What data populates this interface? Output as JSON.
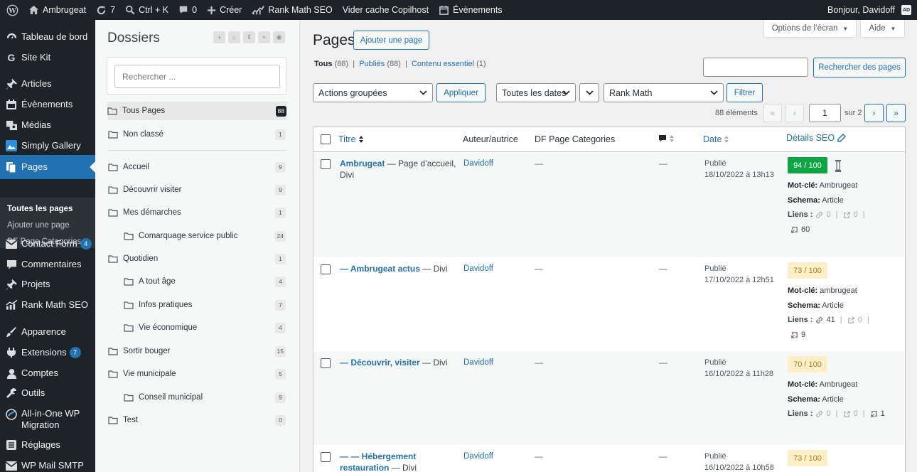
{
  "adminbar": {
    "site_name": "Ambrugeat",
    "updates": "7",
    "search": "Ctrl + K",
    "comments": "0",
    "new": "Créer",
    "rankmath": "Rank Math SEO",
    "cache": "Vider cache Copilhost",
    "events": "Évènements",
    "greeting": "Bonjour, Davidoff",
    "avatar": "AD"
  },
  "menu": {
    "items": [
      {
        "label": "Tableau de bord",
        "icon": "dashboard-icon"
      },
      {
        "label": "Site Kit",
        "icon": "google-icon"
      },
      {
        "label": "Articles",
        "icon": "pin-icon"
      },
      {
        "label": "Évènements",
        "icon": "calendar-icon"
      },
      {
        "label": "Médias",
        "icon": "media-icon"
      },
      {
        "label": "Simply Gallery",
        "icon": "gallery-icon"
      },
      {
        "label": "Pages",
        "icon": "pages-icon"
      },
      {
        "label": "Contact Form",
        "icon": "mail-icon",
        "badge": "4"
      },
      {
        "label": "Commentaires",
        "icon": "comment-icon"
      },
      {
        "label": "Projets",
        "icon": "pin-icon"
      },
      {
        "label": "Rank Math SEO",
        "icon": "chart-icon"
      },
      {
        "label": "Apparence",
        "icon": "brush-icon"
      },
      {
        "label": "Extensions",
        "icon": "plugin-icon",
        "badge": "7"
      },
      {
        "label": "Comptes",
        "icon": "user-icon"
      },
      {
        "label": "Outils",
        "icon": "wrench-icon"
      },
      {
        "label": "All-in-One WP",
        "label2": "Migration",
        "icon": "migration-icon"
      },
      {
        "label": "Réglages",
        "icon": "settings-icon"
      },
      {
        "label": "WP Mail SMTP",
        "icon": "mail-icon"
      }
    ],
    "submenu": [
      "Toutes les pages",
      "Ajouter une page",
      "DF Page Categories"
    ]
  },
  "folders": {
    "title": "Dossiers",
    "search_placeholder": "Rechercher ...",
    "items": [
      {
        "label": "Tous Pages",
        "count": "88"
      },
      {
        "label": "Non classé",
        "count": "1"
      },
      {
        "label": "Accueil",
        "count": "9"
      },
      {
        "label": "Découvrir visiter",
        "count": "9"
      },
      {
        "label": "Mes démarches",
        "count": "1"
      },
      {
        "label": "Comarquage service public",
        "count": "24"
      },
      {
        "label": "Quotidien",
        "count": "1"
      },
      {
        "label": "A tout âge",
        "count": "4"
      },
      {
        "label": "Infos pratiques",
        "count": "7"
      },
      {
        "label": "Vie économique",
        "count": "4"
      },
      {
        "label": "Sortir bouger",
        "count": "15"
      },
      {
        "label": "Vie municipale",
        "count": "5"
      },
      {
        "label": "Conseil municipal",
        "count": "9"
      },
      {
        "label": "Test",
        "count": "0"
      }
    ]
  },
  "main": {
    "title": "Pages",
    "add_button": "Ajouter une page",
    "screen_options": "Options de l’écran",
    "help": "Aide",
    "filters": {
      "all": "Tous",
      "all_count": "(88)",
      "published": "Publiés",
      "published_count": "(88)",
      "essential": "Contenu essentiel",
      "essential_count": "(1)"
    },
    "search_button": "Rechercher des pages",
    "bulk_actions": "Actions groupées",
    "apply": "Appliquer",
    "all_dates": "Toutes les dates",
    "rank_math": "Rank Math",
    "filter": "Filtrer",
    "count_text": "88 éléments",
    "page_current": "1",
    "page_total": "sur 2",
    "columns": {
      "title": "Titre",
      "author": "Auteur/autrice",
      "categories": "DF Page Categories",
      "date": "Date",
      "seo": "Détails SEO"
    }
  },
  "rows": [
    {
      "title": "Ambrugeat",
      "title_suffix": " — Page d’accueil,",
      "title_line2": "Divi",
      "author": "Davidoff",
      "categories": "—",
      "comments": "—",
      "status": "Publié",
      "date": "18/10/2022 à 13h13",
      "score": "94 / 100",
      "score_level": "good",
      "keyword_label": "Mot-clé:",
      "keyword": " Ambrugeat",
      "schema_label": "Schema:",
      "schema": " Article",
      "links_label": "Liens :",
      "internal": "0",
      "external": "0",
      "incoming": "60"
    },
    {
      "title": "— Ambrugeat actus",
      "title_suffix": " — Divi",
      "title_line2": "",
      "author": "Davidoff",
      "categories": "—",
      "comments": "—",
      "status": "Publié",
      "date": "17/10/2022 à 12h51",
      "score": "73 / 100",
      "score_level": "ok",
      "keyword_label": "Mot-clé:",
      "keyword": " ambrugeat",
      "schema_label": "Schema:",
      "schema": " Article",
      "links_label": "Liens :",
      "internal": "41",
      "external": "0",
      "incoming": "9"
    },
    {
      "title": "— Découvrir, visiter",
      "title_suffix": " — Divi",
      "title_line2": "",
      "author": "Davidoff",
      "categories": "—",
      "comments": "—",
      "status": "Publié",
      "date": "16/10/2022 à 11h28",
      "score": "70 / 100",
      "score_level": "ok",
      "keyword_label": "Mot-clé:",
      "keyword": " Ambrugeat",
      "schema_label": "Schema:",
      "schema": " Article",
      "links_label": "Liens :",
      "internal": "0",
      "external": "0",
      "incoming": "1"
    },
    {
      "title": "— — Hébergement",
      "title_line2_link": "restauration",
      "title_suffix": " — Divi",
      "author": "Davidoff",
      "categories": "—",
      "comments": "—",
      "status": "Publié",
      "date": "16/10/2022 à 10h58",
      "score": "73 / 100",
      "score_level": "ok"
    }
  ],
  "colors": {
    "accent": "#2271b1",
    "adminbar": "#1d2327",
    "seo_good": "#10a544",
    "seo_ok": "#fdf0c8"
  }
}
